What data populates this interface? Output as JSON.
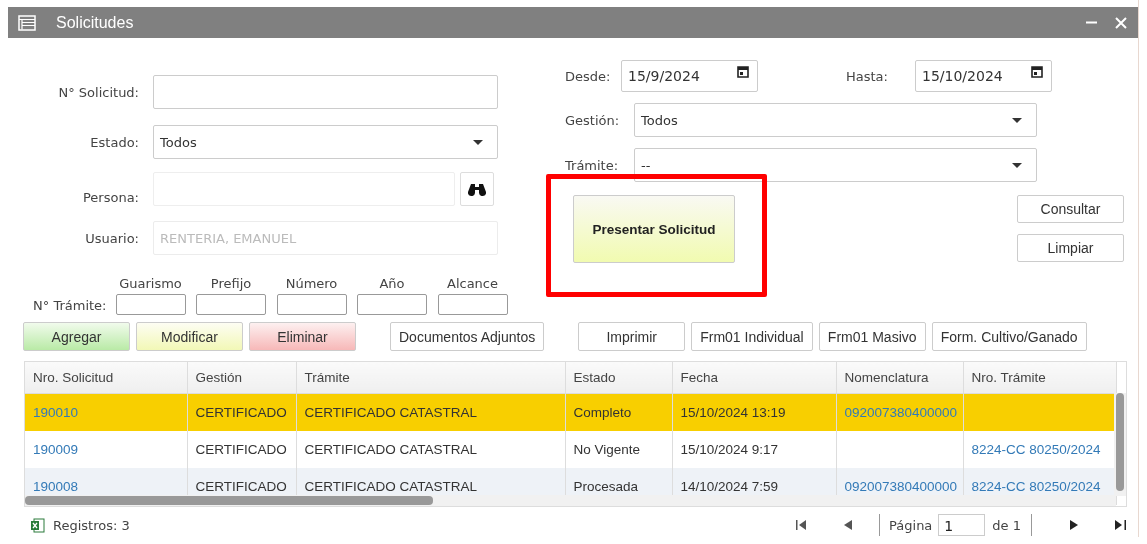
{
  "window": {
    "title": "Solicitudes"
  },
  "form": {
    "solicitud": {
      "label": "N° Solicitud:"
    },
    "estado": {
      "label": "Estado:",
      "value": "Todos"
    },
    "persona": {
      "label": "Persona:"
    },
    "usuario": {
      "label": "Usuario:",
      "value": "RENTERIA, EMANUEL",
      "disabled": true
    },
    "tramite": {
      "label": "N° Trámite:",
      "parts": [
        "Guarismo",
        "Prefijo",
        "Número",
        "Año",
        "Alcance"
      ]
    },
    "desde": {
      "label": "Desde:",
      "value": "15/9/2024"
    },
    "hasta": {
      "label": "Hasta:",
      "value": "15/10/2024"
    },
    "gestion": {
      "label": "Gestión:",
      "value": "Todos"
    },
    "tramite_select": {
      "label": "Trámite:",
      "value": "--"
    }
  },
  "actions": {
    "presentar": "Presentar Solicitud",
    "consultar": "Consultar",
    "limpiar": "Limpiar"
  },
  "highlight": {
    "kind": "frame"
  },
  "toolbar": [
    [
      {
        "label": "Agregar",
        "kind": "add"
      },
      {
        "label": "Modificar",
        "kind": "edit"
      },
      {
        "label": "Eliminar",
        "kind": "delete"
      }
    ],
    [
      {
        "label": "Documentos Adjuntos",
        "kind": "default"
      }
    ],
    [
      {
        "label": "Imprimir",
        "kind": "default"
      },
      {
        "label": "Frm01 Individual",
        "kind": "default"
      },
      {
        "label": "Frm01 Masivo",
        "kind": "default"
      },
      {
        "label": "Form. Cultivo/Ganado",
        "kind": "default"
      }
    ]
  ],
  "table": {
    "columns": [
      {
        "label": "Nro. Solicitud",
        "link": true
      },
      {
        "label": "Gestión",
        "link": false
      },
      {
        "label": "Trámite",
        "link": false
      },
      {
        "label": "Estado",
        "link": false
      },
      {
        "label": "Fecha",
        "link": false
      },
      {
        "label": "Nomenclatura",
        "link": true
      },
      {
        "label": "Nro. Trámite",
        "link": true
      }
    ],
    "rows": [
      {
        "selected": true,
        "cells": [
          "190010",
          "CERTIFICADO",
          "CERTIFICADO CATASTRAL",
          "Completo",
          "15/10/2024 13:19",
          "092007380400000",
          null
        ]
      },
      {
        "selected": false,
        "cells": [
          "190009",
          "CERTIFICADO",
          "CERTIFICADO CATASTRAL",
          "No Vigente",
          "15/10/2024 9:17",
          null,
          "8224-CC 80250/2024"
        ]
      },
      {
        "selected": false,
        "cells": [
          "190008",
          "CERTIFICADO",
          "CERTIFICADO CATASTRAL",
          "Procesada",
          "14/10/2024 7:59",
          "092007380400000",
          "8224-CC 80250/2024"
        ]
      }
    ]
  },
  "footer": {
    "records": "Registros: 3",
    "pager": {
      "page_label": "Página",
      "page": "1",
      "total": "de 1"
    }
  }
}
